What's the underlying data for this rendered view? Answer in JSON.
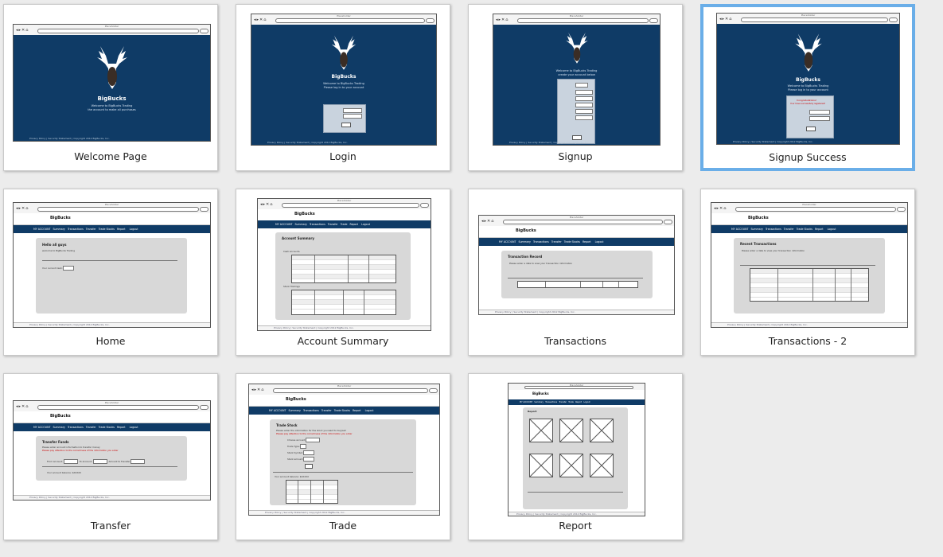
{
  "screens": [
    {
      "id": "welcome",
      "label": "Welcome Page"
    },
    {
      "id": "login",
      "label": "Login"
    },
    {
      "id": "signup",
      "label": "Signup"
    },
    {
      "id": "signup-success",
      "label": "Signup Success"
    },
    {
      "id": "home",
      "label": "Home"
    },
    {
      "id": "account-summary",
      "label": "Account Summary"
    },
    {
      "id": "transactions",
      "label": "Transactions"
    },
    {
      "id": "transactions-2",
      "label": "Transactions - 2"
    },
    {
      "id": "transfer",
      "label": "Transfer"
    },
    {
      "id": "trade",
      "label": "Trade"
    },
    {
      "id": "report",
      "label": "Report"
    }
  ],
  "selected_screen": "Signup Success",
  "mock": {
    "brand": "BigBucks",
    "browser_title": "Placeholder",
    "menu": [
      "MY ACCOUNT",
      "Summary",
      "Transactions",
      "Transfer",
      "Trade Stocks",
      "Report",
      "Logout"
    ],
    "signup_success_message": "Congratulations!",
    "signup_success_sub": "Your have successfully registered!",
    "home_title": "Hello all guys",
    "account_summary_title": "Account Summary",
    "account_summary_section1": "Cash Accounts",
    "account_summary_section2": "Stock Holdings",
    "transaction_record_title": "Transaction Record",
    "recent_transactions_title": "Recent Transactions",
    "transfer_title": "Transfer Funds",
    "trade_title": "Trade Stock",
    "report_title": "Report",
    "footer": "Privacy Policy | Security Statement | Copyright 2012 BigBucks, Inc."
  },
  "colors": {
    "navy": "#0f3b66",
    "selected_border": "#6aaee8",
    "panel": "#d8d8d8"
  }
}
